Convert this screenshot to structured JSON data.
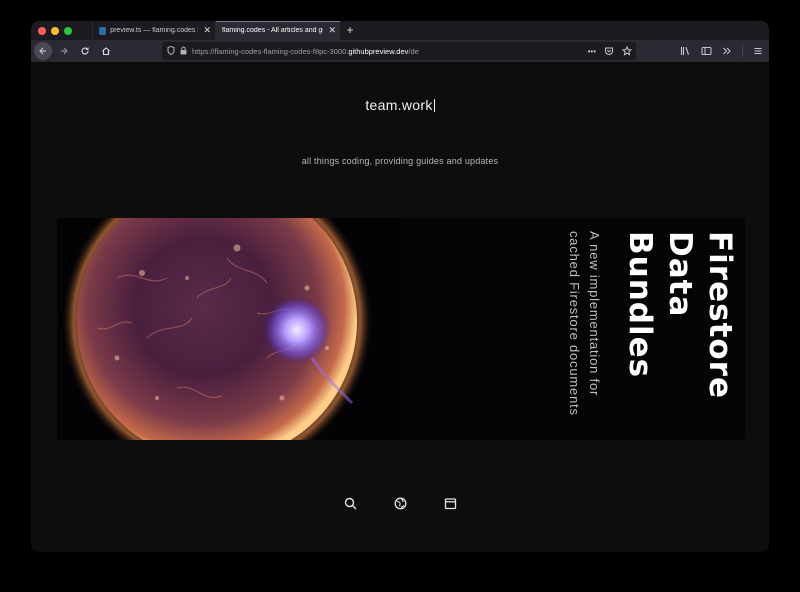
{
  "browser": {
    "tabs": [
      {
        "title": "preview.ts — flaming.codes [Co",
        "close": "✕"
      },
      {
        "title": "flaming.codes - All articles and guid",
        "close": "✕"
      }
    ],
    "new_tab": "+",
    "url": {
      "prefix": "https://flaming-codes-flaming-codes-f8pc-3000.",
      "domain": "githubpreview.dev",
      "path": "/de"
    },
    "url_actions": {
      "more": "•••"
    }
  },
  "page": {
    "brand": "team.work",
    "tagline": "all things coding, providing guides and updates",
    "card": {
      "title_lines": [
        "Firestore",
        "Data",
        "Bundles"
      ],
      "subtitle_lines": [
        "A new implementation for",
        "cached Firestore documents"
      ]
    },
    "bottom_icons": [
      "search-icon",
      "globe-icon",
      "archive-icon"
    ]
  }
}
